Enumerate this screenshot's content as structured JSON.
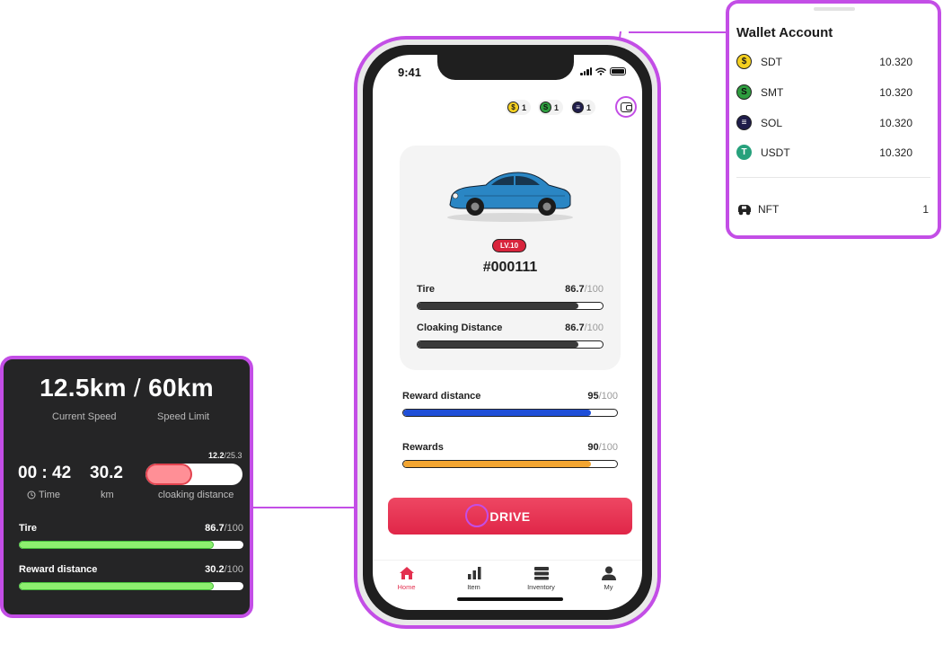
{
  "phone": {
    "status_time": "9:41",
    "coins": [
      {
        "icon": "sdt-coin-icon",
        "glyph": "$",
        "amount": "1"
      },
      {
        "icon": "smt-coin-icon",
        "glyph": "S",
        "amount": "1"
      },
      {
        "icon": "sol-coin-icon",
        "glyph": "≡",
        "amount": "1"
      }
    ],
    "car": {
      "level": "LV.10",
      "id": "#000111",
      "body_color": "#2a86c4",
      "stats": [
        {
          "label": "Tire",
          "value": "86.7",
          "max": "/100",
          "fraction": 0.867
        },
        {
          "label": "Cloaking Distance",
          "value": "86.7",
          "max": "/100",
          "fraction": 0.867
        }
      ]
    },
    "progress": [
      {
        "label": "Reward distance",
        "value": "95",
        "max": "/100",
        "fraction": 0.88,
        "color": "#1f4fd8"
      },
      {
        "label": "Rewards",
        "value": "90",
        "max": "/100",
        "fraction": 0.88,
        "color": "#f2a531"
      }
    ],
    "drive_label": "DRIVE",
    "tabs": [
      {
        "label": "Home",
        "icon": "home-icon",
        "active": true
      },
      {
        "label": "Item",
        "icon": "bar-chart-icon",
        "active": false
      },
      {
        "label": "Inventory",
        "icon": "inventory-icon",
        "active": false
      },
      {
        "label": "My",
        "icon": "user-icon",
        "active": false
      }
    ]
  },
  "wallet": {
    "title": "Wallet Account",
    "rows": [
      {
        "name": "SDT",
        "value": "10.320",
        "icon": "sdt-coin-icon",
        "glyph": "$"
      },
      {
        "name": "SMT",
        "value": "10.320",
        "icon": "smt-coin-icon",
        "glyph": "S"
      },
      {
        "name": "SOL",
        "value": "10.320",
        "icon": "sol-coin-icon",
        "glyph": "≡"
      },
      {
        "name": "USDT",
        "value": "10.320",
        "icon": "usdt-coin-icon",
        "glyph": "T"
      }
    ],
    "nft": {
      "name": "NFT",
      "value": "1",
      "icon": "car-icon"
    }
  },
  "drive_panel": {
    "speed": "12.5km",
    "separator": "/",
    "limit": "60km",
    "speed_label": "Current Speed",
    "limit_label": "Speed Limit",
    "cloak_value": "12.2",
    "cloak_max": "/25.3",
    "cloak_fraction": 0.482,
    "time": "00 : 42",
    "km": "30.2",
    "time_label": "Time",
    "km_label": "km",
    "cloak_label": "cloaking distance",
    "stats": [
      {
        "label": "Tire",
        "value": "86.7",
        "max": "/100",
        "fraction": 0.867
      },
      {
        "label": "Reward distance",
        "value": "30.2",
        "max": "/100",
        "fraction": 0.867
      }
    ]
  },
  "colors": {
    "accent": "#c34ee6",
    "primary": "#e3304f",
    "panel_dark": "#252526"
  }
}
